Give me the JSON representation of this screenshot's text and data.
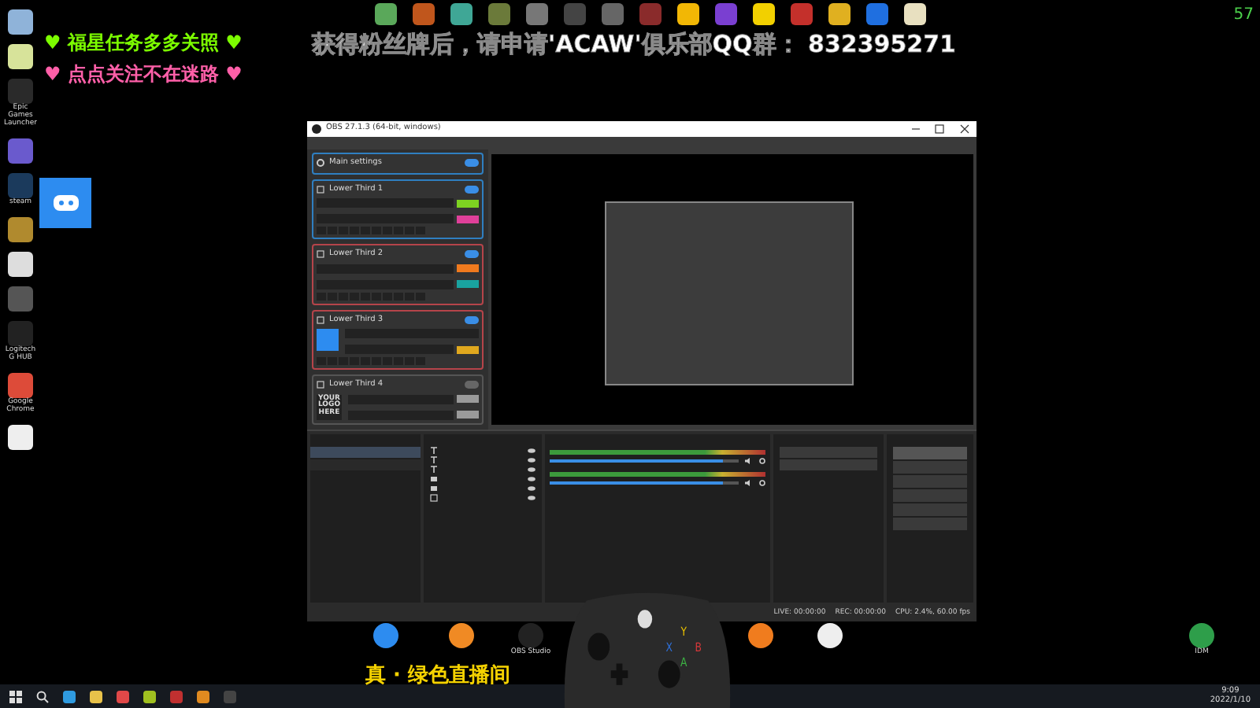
{
  "overlay": {
    "line1": "♥ 福星任务多多关照 ♥",
    "line2": "♥ 点点关注不在迷路 ♥",
    "banner": "获得粉丝牌后，请申请'ACAW'俱乐部QQ群： 832395271",
    "caption": "真 · 绿色直播间",
    "fps": "57"
  },
  "top_icons": [
    {
      "color": "#5aa85a"
    },
    {
      "color": "#c0561c"
    },
    {
      "color": "#3fa796"
    },
    {
      "color": "#6b7a3a"
    },
    {
      "color": "#777777"
    },
    {
      "color": "#444444"
    },
    {
      "color": "#666666"
    },
    {
      "color": "#8a2b2b"
    },
    {
      "color": "#f2b705"
    },
    {
      "color": "#7a3fd1"
    },
    {
      "color": "#f2d000"
    },
    {
      "color": "#c4302b"
    },
    {
      "color": "#e0b020"
    },
    {
      "color": "#1f6fe0"
    },
    {
      "color": "#e8e0c0"
    }
  ],
  "desktop_icons": [
    {
      "color": "#8fb3d9"
    },
    {
      "color": "#d7e39a"
    },
    {
      "label": "Epic Games Launcher",
      "color": "#2a2a2a"
    },
    {
      "color": "#6a5acd"
    },
    {
      "label": "steam",
      "color": "#1b3a5c"
    },
    {
      "color": "#b08a2e"
    },
    {
      "color": "#dddddd"
    },
    {
      "color": "#555555"
    },
    {
      "label": "Logitech G HUB",
      "color": "#222222"
    },
    {
      "label": "Google Chrome",
      "color": "#dd4b39"
    },
    {
      "color": "#eeeeee"
    }
  ],
  "obs": {
    "title": "OBS 27.1.3 (64-bit, windows)",
    "panels": [
      {
        "kind": "settings",
        "title": "Main settings",
        "color": "#2f7fc1",
        "enabled": true
      },
      {
        "kind": "text",
        "title": "Lower Third 1",
        "color": "#2f7fc1",
        "enabled": true,
        "rows": [
          {
            "color": "#7ed321"
          },
          {
            "color": "#e0409a"
          }
        ]
      },
      {
        "kind": "text",
        "title": "Lower Third 2",
        "color": "#b5444a",
        "enabled": true,
        "rows": [
          {
            "color": "#f07a1e"
          },
          {
            "color": "#19a3a0"
          }
        ]
      },
      {
        "kind": "image",
        "title": "Lower Third 3",
        "color": "#b5444a",
        "enabled": true,
        "rows": [
          {
            "tagged": false
          },
          {
            "tagged": true,
            "color": "#e0a81e"
          }
        ]
      },
      {
        "kind": "logo",
        "title": "Lower Third 4",
        "color": "#555555",
        "enabled": false,
        "logo": "YOUR LOGO HERE",
        "rows": [
          {
            "color": "#9a9a9a"
          },
          {
            "color": "#9a9a9a"
          }
        ]
      }
    ],
    "scenes": [
      {
        "selected": true
      },
      {
        "selected": false
      }
    ],
    "sources": [
      {
        "kind": "text"
      },
      {
        "kind": "text"
      },
      {
        "kind": "text"
      },
      {
        "kind": "capture"
      },
      {
        "kind": "capture"
      },
      {
        "kind": "image"
      }
    ],
    "mixer": [
      {
        "level": 0.92
      },
      {
        "level": 0.92
      }
    ],
    "controls": [
      {
        "selected": true
      },
      {
        "selected": false
      },
      {
        "selected": false
      },
      {
        "selected": false
      },
      {
        "selected": false
      },
      {
        "selected": false
      }
    ],
    "status": [
      "LIVE: 00:00:00",
      "REC: 00:00:00",
      "CPU: 2.4%, 60.00 fps"
    ]
  },
  "bottom_icons": [
    {
      "color": "#2d8cf0"
    },
    {
      "color": "#f08a24"
    },
    {
      "label": "OBS Studio",
      "color": "#222222"
    },
    {
      "color": "#f07c1e"
    },
    {
      "color": "#eeeeee"
    },
    {
      "label": "IDM",
      "color": "#2e9e4a"
    }
  ],
  "controller": {
    "buttons": [
      {
        "label": "Y",
        "color": "#e8c000"
      },
      {
        "label": "X",
        "color": "#2f6fd6"
      },
      {
        "label": "A",
        "color": "#3cb043"
      },
      {
        "label": "B",
        "color": "#d8383a"
      }
    ]
  },
  "taskbar": {
    "apps": [
      {
        "color": "#2f9be0"
      },
      {
        "color": "#e8c24a"
      },
      {
        "color": "#e04848"
      },
      {
        "color": "#a0c020"
      },
      {
        "color": "#c03030"
      },
      {
        "color": "#e08a20"
      },
      {
        "color": "#444444"
      }
    ],
    "time": "9:09",
    "date": "2022/1/10"
  }
}
